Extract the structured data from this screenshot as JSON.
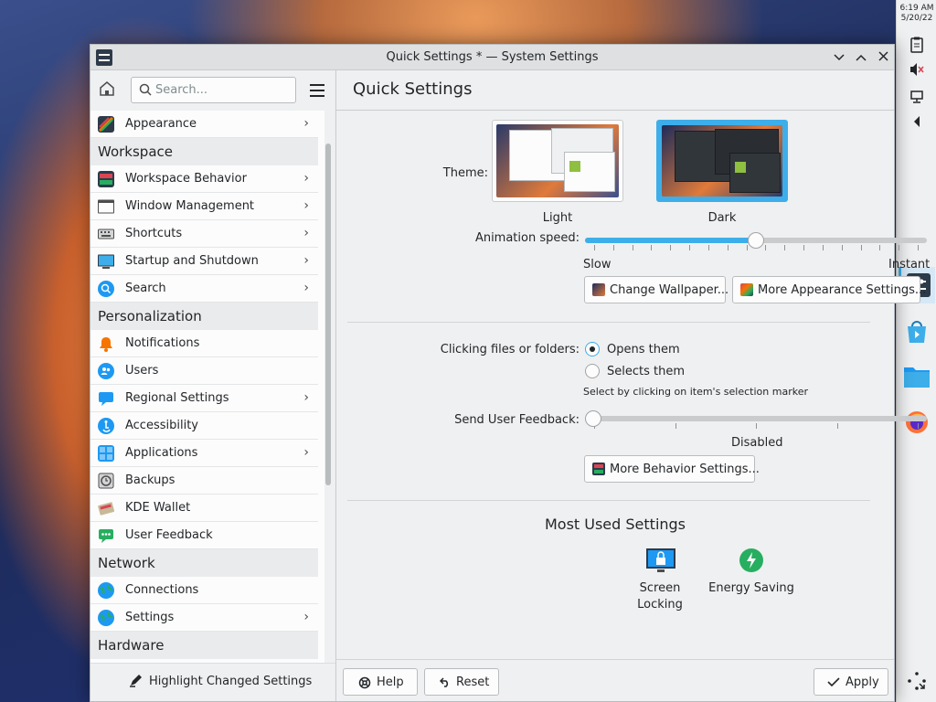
{
  "desktop": {
    "clock_time": "6:19 AM",
    "clock_date": "5/20/22"
  },
  "window": {
    "title": "Quick Settings * — System Settings"
  },
  "sidebar": {
    "search_placeholder": "Search...",
    "top_items": [
      {
        "label": "Appearance",
        "has_children": true
      }
    ],
    "categories": [
      {
        "name": "Workspace",
        "items": [
          {
            "label": "Workspace Behavior",
            "has_children": true
          },
          {
            "label": "Window Management",
            "has_children": true
          },
          {
            "label": "Shortcuts",
            "has_children": true
          },
          {
            "label": "Startup and Shutdown",
            "has_children": true
          },
          {
            "label": "Search",
            "has_children": true
          }
        ]
      },
      {
        "name": "Personalization",
        "items": [
          {
            "label": "Notifications",
            "has_children": false
          },
          {
            "label": "Users",
            "has_children": false
          },
          {
            "label": "Regional Settings",
            "has_children": true
          },
          {
            "label": "Accessibility",
            "has_children": false
          },
          {
            "label": "Applications",
            "has_children": true
          },
          {
            "label": "Backups",
            "has_children": false
          },
          {
            "label": "KDE Wallet",
            "has_children": false
          },
          {
            "label": "User Feedback",
            "has_children": false
          }
        ]
      },
      {
        "name": "Network",
        "items": [
          {
            "label": "Connections",
            "has_children": false
          },
          {
            "label": "Settings",
            "has_children": true
          }
        ]
      },
      {
        "name": "Hardware",
        "items": []
      }
    ],
    "footer_label": "Highlight Changed Settings"
  },
  "main": {
    "title": "Quick Settings",
    "theme_label": "Theme:",
    "themes": [
      {
        "label": "Light",
        "selected": false
      },
      {
        "label": "Dark",
        "selected": true
      }
    ],
    "animation_label": "Animation speed:",
    "animation_min": "Slow",
    "animation_max": "Instant",
    "animation_level": 0.5,
    "change_wallpaper_button": "Change Wallpaper...",
    "more_appearance_button": "More Appearance Settings...",
    "clicking_label": "Clicking files or folders:",
    "clicking_options": [
      {
        "label": "Opens them",
        "checked": true
      },
      {
        "label": "Selects them",
        "checked": false
      }
    ],
    "clicking_hint": "Select by clicking on item's selection marker",
    "feedback_label": "Send User Feedback:",
    "feedback_value": "Disabled",
    "feedback_level": 0,
    "more_behavior_button": "More Behavior Settings...",
    "most_used_title": "Most Used Settings",
    "most_used": [
      {
        "label_line1": "Screen",
        "label_line2": "Locking"
      },
      {
        "label_line1": "Energy Saving",
        "label_line2": ""
      }
    ],
    "help_button": "Help",
    "reset_button": "Reset",
    "apply_button": "Apply"
  },
  "colors": {
    "accent": "#3daee9",
    "window_bg": "#eff0f1",
    "view_bg": "#fcfcfc",
    "text": "#232629"
  }
}
